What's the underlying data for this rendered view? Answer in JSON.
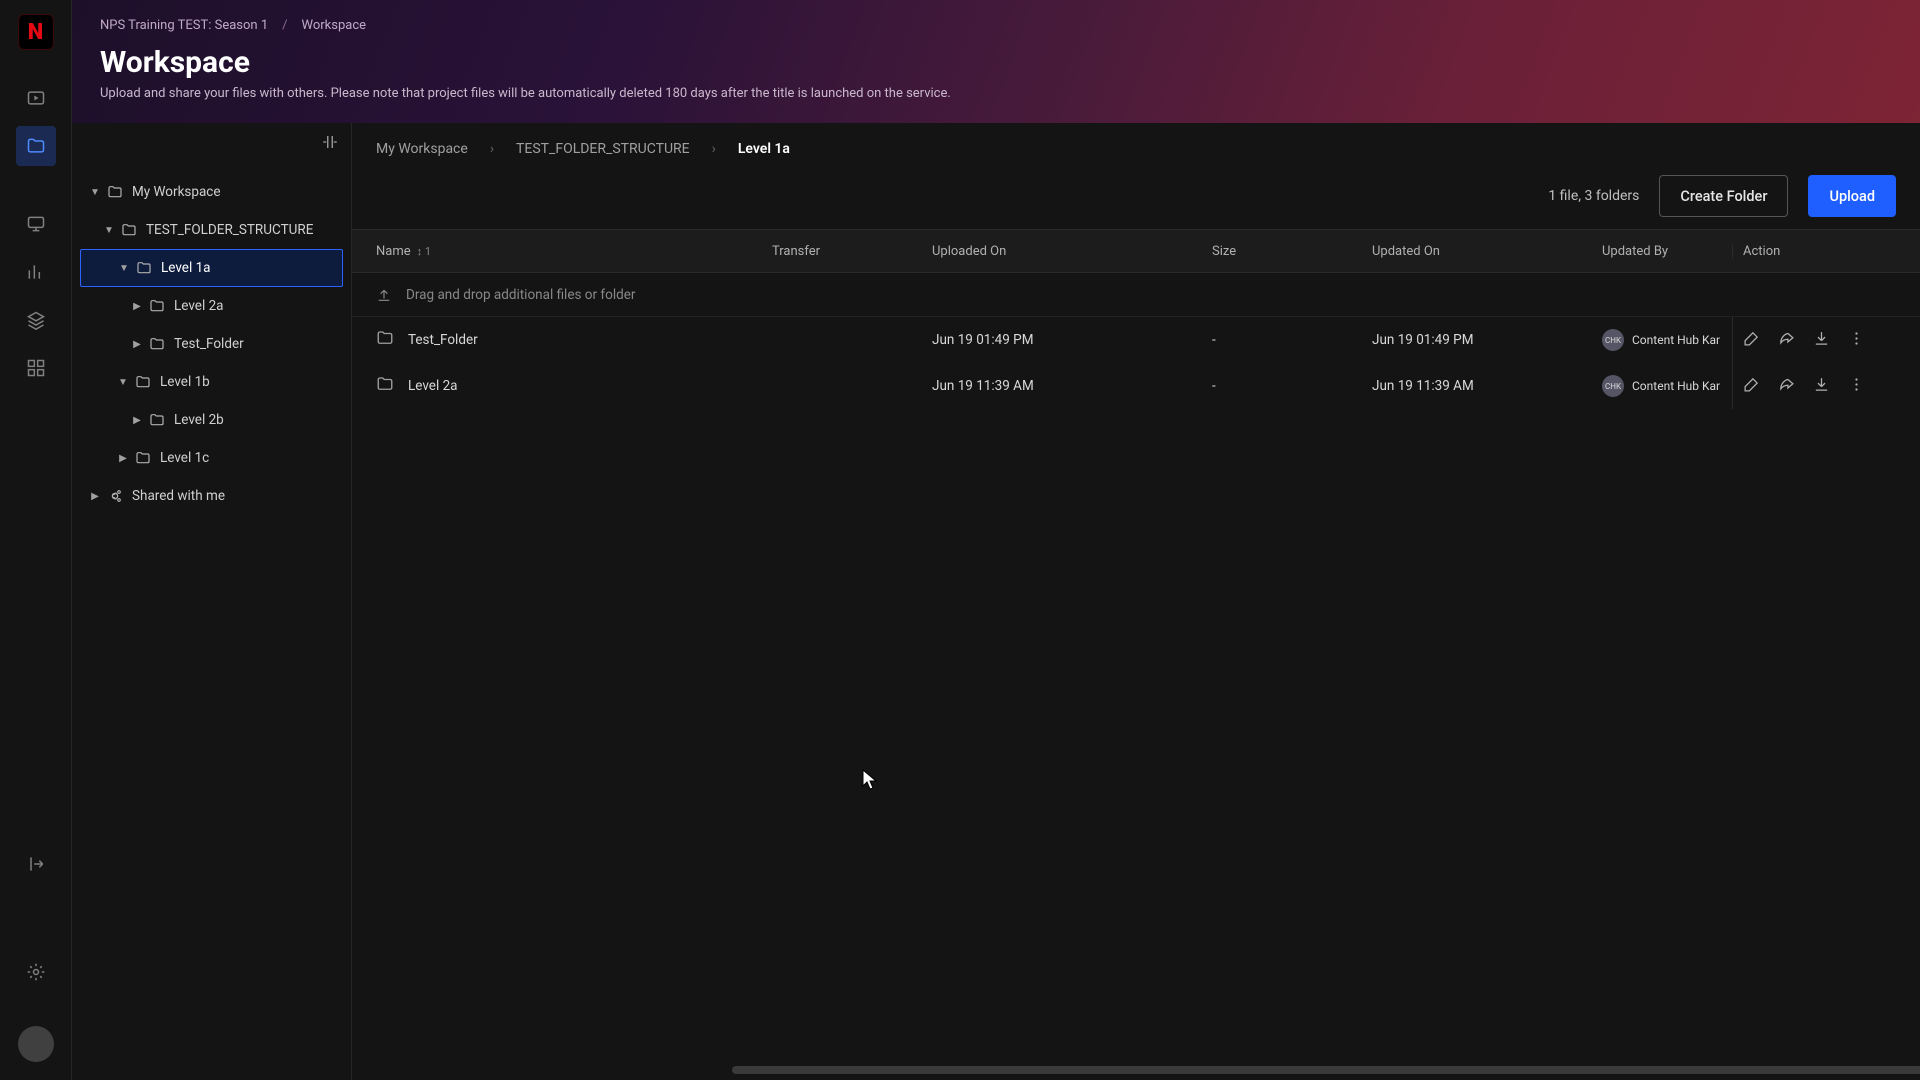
{
  "brand_initial": "N",
  "top_crumbs": {
    "project": "NPS Training TEST: Season 1",
    "section": "Workspace"
  },
  "page": {
    "title": "Workspace",
    "subtitle": "Upload and share your files with others. Please note that project files will be automatically deleted 180 days after the title is launched on the service."
  },
  "tree": {
    "my_workspace": "My Workspace",
    "test_folder_structure": "TEST_FOLDER_STRUCTURE",
    "level_1a": "Level 1a",
    "level_2a": "Level 2a",
    "test_folder": "Test_Folder",
    "level_1b": "Level 1b",
    "level_2b": "Level 2b",
    "level_1c": "Level 1c",
    "shared_with_me": "Shared with me"
  },
  "inner_crumbs": {
    "a": "My Workspace",
    "b": "TEST_FOLDER_STRUCTURE",
    "c": "Level 1a"
  },
  "toolbar": {
    "count": "1 file, 3 folders",
    "create_folder": "Create Folder",
    "upload": "Upload"
  },
  "columns": {
    "name": "Name",
    "sort": "↕ 1",
    "transfer": "Transfer",
    "uploaded_on": "Uploaded On",
    "size": "Size",
    "updated_on": "Updated On",
    "updated_by": "Updated By",
    "action": "Action"
  },
  "drop_hint": "Drag and drop additional files or folder",
  "rows": [
    {
      "name": "Test_Folder",
      "uploaded": "Jun 19 01:49 PM",
      "size": "-",
      "updated": "Jun 19 01:49 PM",
      "by": "Content Hub Kar",
      "avatar": "CHK"
    },
    {
      "name": "Level 2a",
      "uploaded": "Jun 19 11:39 AM",
      "size": "-",
      "updated": "Jun 19 11:39 AM",
      "by": "Content Hub Kar",
      "avatar": "CHK"
    }
  ]
}
